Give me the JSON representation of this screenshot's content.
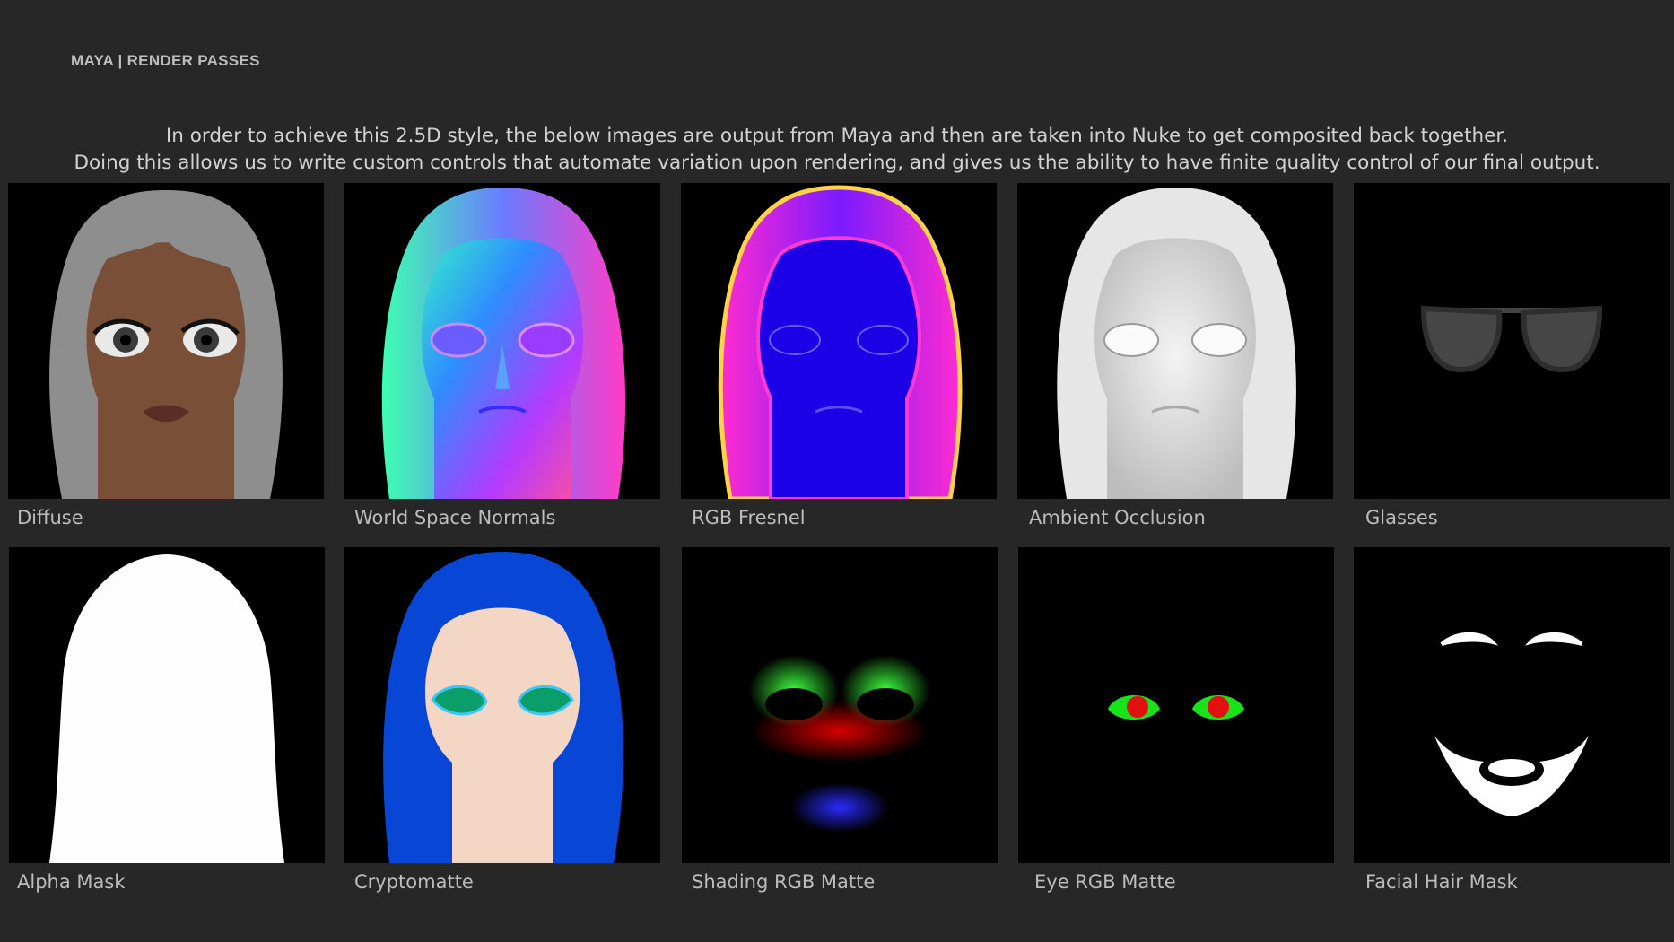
{
  "header": {
    "label": "MAYA | RENDER PASSES"
  },
  "intro": {
    "line1": "In order to achieve this 2.5D style, the below images are output from Maya and then are taken into Nuke to get composited back together.",
    "line2": "Doing this allows us to write custom controls that automate variation upon rendering, and gives us the ability to have finite quality control of our final output."
  },
  "passes": [
    {
      "caption": "Diffuse"
    },
    {
      "caption": "World Space Normals"
    },
    {
      "caption": "RGB Fresnel"
    },
    {
      "caption": "Ambient Occlusion"
    },
    {
      "caption": "Glasses"
    },
    {
      "caption": "Alpha Mask"
    },
    {
      "caption": "Cryptomatte"
    },
    {
      "caption": "Shading RGB Matte"
    },
    {
      "caption": "Eye RGB Matte"
    },
    {
      "caption": "Facial Hair Mask"
    }
  ]
}
